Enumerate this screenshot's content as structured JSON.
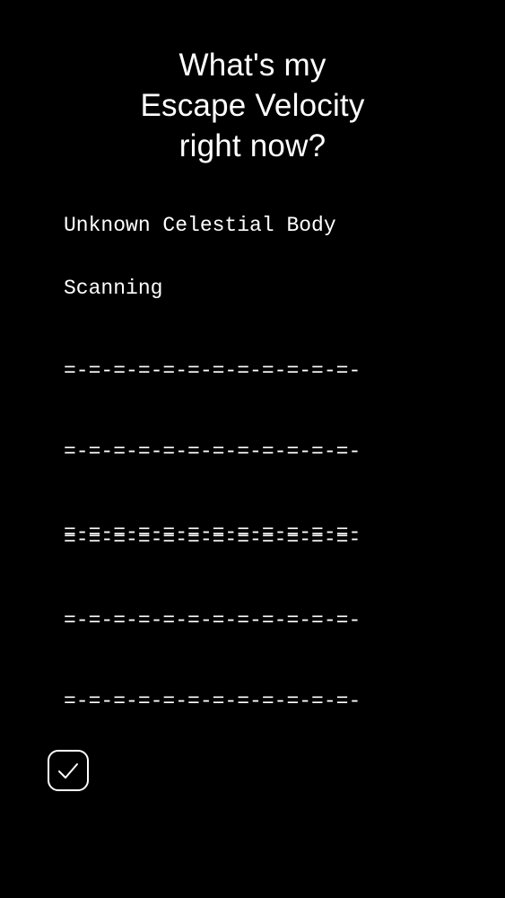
{
  "header": {
    "title_lines": [
      "What's my",
      "Escape Velocity",
      "right now?"
    ]
  },
  "readout": {
    "body_name": "Unknown Celestial Body",
    "status": "Scanning",
    "rules_top": [
      "=-=-=-=-=-=-=-=-=-=-=-=-",
      "=-=-=-=-=-=-=-=-=-=-=-=-",
      "=-=-=-=-=-=-=-=-=-=-=-=-"
    ],
    "rules_bottom": [
      "=-=-=-=-=-=-=-=-=-=-=-=-",
      "=-=-=-=-=-=-=-=-=-=-=-=-",
      "=-=-=-=-=-=-=-=-=-=-=-=-"
    ]
  },
  "controls": {
    "confirm_icon": "checkmark-icon"
  },
  "colors": {
    "background": "#000000",
    "foreground": "#ffffff"
  }
}
